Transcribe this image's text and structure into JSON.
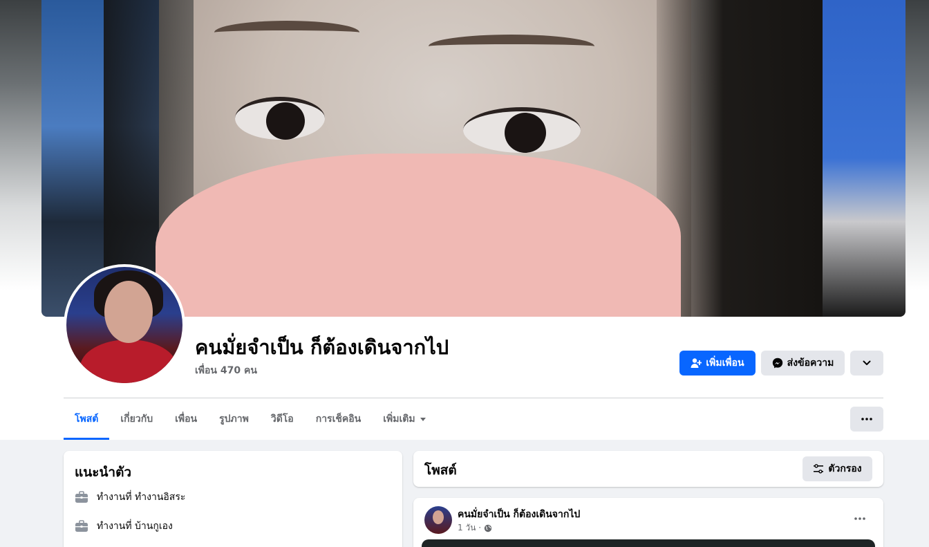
{
  "profile": {
    "name": "คนมั่ยจำเป็น ก็ต้องเดินจากไป",
    "friends_count": "เพื่อน 470 คน"
  },
  "actions": {
    "add_friend": "เพิ่มเพื่อน",
    "message": "ส่งข้อความ"
  },
  "tabs": [
    {
      "label": "โพสต์",
      "active": true
    },
    {
      "label": "เกี่ยวกับ"
    },
    {
      "label": "เพื่อน"
    },
    {
      "label": "รูปภาพ"
    },
    {
      "label": "วิดีโอ"
    },
    {
      "label": "การเช็คอิน"
    },
    {
      "label": "เพิ่มเติม"
    }
  ],
  "intro": {
    "title": "แนะนำตัว",
    "items": [
      {
        "icon": "briefcase-icon",
        "text": "ทำงานที่ ทำงานอิสระ"
      },
      {
        "icon": "briefcase-icon",
        "text": "ทำงานที่ บ้านกูเอง"
      }
    ]
  },
  "posts": {
    "title": "โพสต์",
    "filter_label": "ตัวกรอง",
    "items": [
      {
        "author": "คนมั่ยจำเป็น ก็ต้องเดินจากไป",
        "time": "1 วัน ·",
        "privacy_icon": "globe-icon"
      }
    ]
  },
  "colors": {
    "accent": "#0866ff",
    "button_gray": "#e4e6eb",
    "secondary_text": "#65676b",
    "page_bg": "#f0f2f5"
  }
}
